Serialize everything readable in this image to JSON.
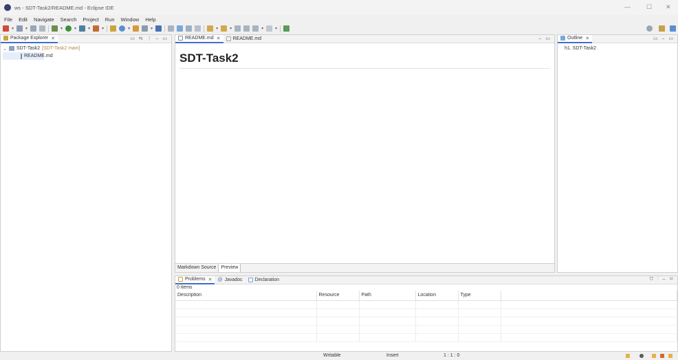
{
  "window": {
    "title": "ws - SDT-Task2/README.md - Eclipse IDE",
    "controls": [
      "—",
      "☐",
      "✕"
    ]
  },
  "menu": [
    "File",
    "Edit",
    "Navigate",
    "Search",
    "Project",
    "Run",
    "Window",
    "Help"
  ],
  "package_explorer": {
    "tab_label": "Package Explorer",
    "project": "SDT-Task2",
    "project_suffix": "[SDT-Task2 main]",
    "file": "README.md"
  },
  "editor": {
    "tabs": [
      {
        "label": "README.md",
        "active": true
      },
      {
        "label": "README.md",
        "active": false
      }
    ],
    "heading": "SDT-Task2",
    "bottom_tabs": [
      "Markdown Source",
      "Preview"
    ]
  },
  "outline": {
    "tab_label": "Outline",
    "items": [
      "h1. SDT-Task2"
    ]
  },
  "problems": {
    "tabs": [
      "Problems",
      "Javadoc",
      "Declaration"
    ],
    "count": "0 items",
    "columns": [
      "Description",
      "Resource",
      "Path",
      "Location",
      "Type"
    ]
  },
  "status": {
    "mode": "Writable",
    "insert": "Insert",
    "position": "1 : 1 : 0"
  },
  "colors": {
    "accent": "#3c6ecb",
    "project_suffix": "#b7854b"
  }
}
